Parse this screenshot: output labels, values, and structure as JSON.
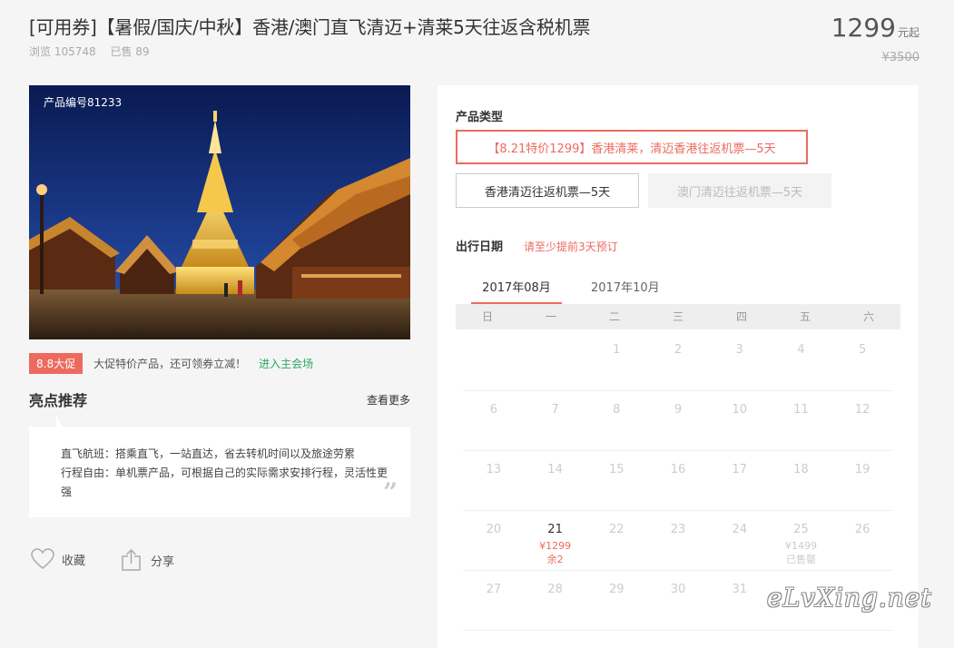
{
  "header": {
    "title": "[可用券]【暑假/国庆/中秋】香港/澳门直飞清迈+清莱5天往返含税机票",
    "views": "浏览 105748",
    "sold": "已售 89",
    "price": "1299",
    "price_unit": "元起",
    "original_price": "¥3500"
  },
  "hero": {
    "product_id": "产品编号81233"
  },
  "promo": {
    "tag": "8.8大促",
    "text": "大促特价产品，还可领券立减！",
    "link": "进入主会场"
  },
  "highlights": {
    "title": "亮点推荐",
    "see_more": "查看更多",
    "line1": "直飞航班：搭乘直飞，一站直达，省去转机时间以及旅途劳累",
    "line2": "行程自由：单机票产品，可根据自己的实际需求安排行程，灵活性更强",
    "quote": "”"
  },
  "actions": {
    "favorite": "收藏",
    "share": "分享"
  },
  "product_types": {
    "label": "产品类型",
    "options": [
      "【8.21特价1299】香港清莱，清迈香港往返机票—5天",
      "香港清迈往返机票—5天",
      "澳门清迈往返机票—5天"
    ]
  },
  "travel_date": {
    "label": "出行日期",
    "note": "请至少提前3天预订",
    "months": [
      "2017年08月",
      "2017年10月"
    ],
    "weekdays": [
      "日",
      "一",
      "二",
      "三",
      "四",
      "五",
      "六"
    ],
    "weeks": [
      [
        {
          "d": ""
        },
        {
          "d": ""
        },
        {
          "d": "1"
        },
        {
          "d": "2"
        },
        {
          "d": "3"
        },
        {
          "d": "4"
        },
        {
          "d": "5"
        }
      ],
      [
        {
          "d": "6"
        },
        {
          "d": "7"
        },
        {
          "d": "8"
        },
        {
          "d": "9"
        },
        {
          "d": "10"
        },
        {
          "d": "11"
        },
        {
          "d": "12"
        }
      ],
      [
        {
          "d": "13"
        },
        {
          "d": "14"
        },
        {
          "d": "15"
        },
        {
          "d": "16"
        },
        {
          "d": "17"
        },
        {
          "d": "18"
        },
        {
          "d": "19"
        }
      ],
      [
        {
          "d": "20"
        },
        {
          "d": "21",
          "price": "¥1299",
          "stock": "余2",
          "state": "active"
        },
        {
          "d": "22"
        },
        {
          "d": "23"
        },
        {
          "d": "24"
        },
        {
          "d": "25",
          "price": "¥1499",
          "stock": "已售罄",
          "state": "soldout"
        },
        {
          "d": "26"
        }
      ],
      [
        {
          "d": "27"
        },
        {
          "d": "28"
        },
        {
          "d": "29"
        },
        {
          "d": "30"
        },
        {
          "d": "31"
        },
        {
          "d": ""
        },
        {
          "d": ""
        }
      ]
    ]
  },
  "watermark": "eLvXing.net",
  "colors": {
    "accent": "#ec6b5e",
    "link": "#2aa865",
    "panel_bg": "#ffffff",
    "page_bg": "#f5f5f5"
  },
  "icons": {
    "favorite": "heart-outline-icon",
    "share": "share-box-icon",
    "quote": "quote-mark-icon"
  }
}
